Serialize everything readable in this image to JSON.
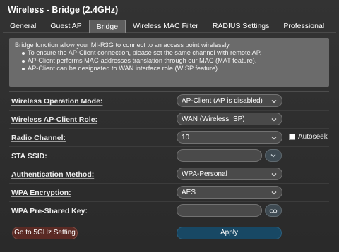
{
  "page": {
    "title": "Wireless - Bridge (2.4GHz)"
  },
  "tabs": [
    {
      "label": "General"
    },
    {
      "label": "Guest AP"
    },
    {
      "label": "Bridge",
      "active": true
    },
    {
      "label": "Wireless MAC Filter"
    },
    {
      "label": "RADIUS Settings"
    },
    {
      "label": "Professional"
    }
  ],
  "info": {
    "intro": "Bridge function allow your MI-R3G to connect to an access point wirelessly.",
    "bullets": [
      "To ensure the AP-Client connection, please set the same channel with remote AP.",
      "AP-Client performs MAC-addresses translation through our MAC (MAT feature).",
      "AP-Client can be designated to WAN interface role (WISP feature)."
    ]
  },
  "form": {
    "wireless_mode": {
      "label": "Wireless Operation Mode:",
      "value": "AP-Client (AP is disabled)"
    },
    "client_role": {
      "label": "Wireless AP-Client Role:",
      "value": "WAN (Wireless ISP)"
    },
    "radio_channel": {
      "label": "Radio Channel:",
      "value": "10",
      "autoseek_label": "Autoseek",
      "autoseek_checked": false
    },
    "sta_ssid": {
      "label": "STA SSID:",
      "value": ""
    },
    "auth_method": {
      "label": "Authentication Method:",
      "value": "WPA-Personal"
    },
    "wpa_encryption": {
      "label": "WPA Encryption:",
      "value": "AES"
    },
    "wpa_psk": {
      "label": "WPA Pre-Shared Key:",
      "value": ""
    }
  },
  "buttons": {
    "go_5ghz": "Go to 5GHz Setting",
    "apply": "Apply"
  },
  "icons": {
    "select_chevron": "chevron-down-icon",
    "ssid_dropdown": "chevron-down-icon",
    "show_password": "eye-icon"
  },
  "colors": {
    "apply_button": "#184864",
    "go_5ghz_button": "#5a2a24",
    "info_background": "#6b6b6b"
  }
}
